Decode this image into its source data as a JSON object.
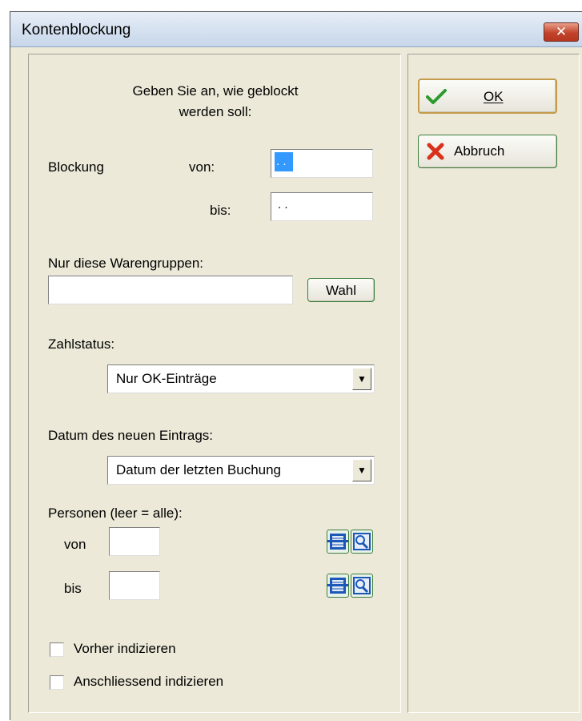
{
  "window": {
    "title": "Kontenblockung",
    "close_glyph": "✕"
  },
  "intro": {
    "line1": "Geben Sie an, wie geblockt",
    "line2": "werden soll:"
  },
  "blockung": {
    "label": "Blockung",
    "von_label": "von:",
    "von_value": ". .",
    "bis_label": "bis:",
    "bis_value": ". ."
  },
  "warengruppen": {
    "label": "Nur diese Warengruppen:",
    "value": "",
    "button": "Wahl"
  },
  "zahlstatus": {
    "label": "Zahlstatus:",
    "selected": "Nur OK-Einträge"
  },
  "datum": {
    "label": "Datum des neuen Eintrags:",
    "selected": "Datum der letzten Buchung"
  },
  "personen": {
    "label": "Personen (leer = alle):",
    "von_label": "von",
    "von_value": "",
    "bis_label": "bis",
    "bis_value": ""
  },
  "options": {
    "vorher": {
      "label": "Vorher indizieren",
      "checked": false
    },
    "anschliessend": {
      "label": "Anschliessend indizieren",
      "checked": false
    }
  },
  "buttons": {
    "ok": "OK",
    "cancel": "Abbruch"
  },
  "icons": {
    "dropdown": "▼",
    "ok": "check-icon",
    "cancel": "cross-icon",
    "list": "list-icon",
    "search": "magnifier-icon"
  }
}
